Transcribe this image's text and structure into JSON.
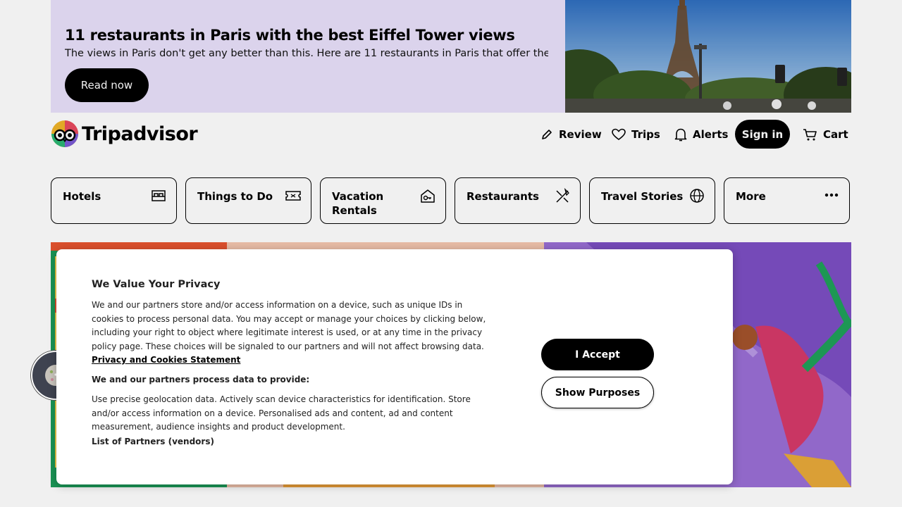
{
  "promo": {
    "title": "11 restaurants in Paris with the best Eiffel Tower views",
    "description": "The views in Paris don't get any better than this. Here are 11 restaurants in Paris that offer the ...",
    "button_label": "Read now"
  },
  "header": {
    "brand": "Tripadvisor",
    "nav": {
      "review": "Review",
      "trips": "Trips",
      "alerts": "Alerts",
      "signin": "Sign in",
      "cart": "Cart"
    }
  },
  "categories": [
    {
      "label": "Hotels",
      "icon": "bed-icon"
    },
    {
      "label": "Things to Do",
      "icon": "ticket-icon"
    },
    {
      "label": "Vacation Rentals",
      "icon": "house-key-icon"
    },
    {
      "label": "Restaurants",
      "icon": "fork-knife-icon"
    },
    {
      "label": "Travel Stories",
      "icon": "globe-icon"
    },
    {
      "label": "More",
      "icon": "more-dots-icon"
    }
  ],
  "consent": {
    "title": "We Value Your Privacy",
    "body": "We and our partners store and/or access information on a device, such as unique IDs in cookies to process personal data. You may accept or manage your choices by clicking below, including your right to object where legitimate interest is used, or at any time in the privacy policy page. These choices will be signaled to our partners and will not affect browsing data.",
    "policy_link": "Privacy and Cookies Statement",
    "purposes_heading": "We and our partners process data to provide:",
    "purposes_text": "Use precise geolocation data. Actively scan device characteristics for identification. Store and/or access information on a device. Personalised ads and content, ad and content measurement, audience insights and product development.",
    "partners_link": "List of Partners (vendors)",
    "accept_label": "I Accept",
    "purposes_label": "Show Purposes"
  },
  "colors": {
    "promo_bg": "#e9e1fb",
    "button_black": "#000000",
    "hero_purple": "#9b6fd6",
    "hero_green": "#1fa15a",
    "cookie_fab": "#3f4350"
  }
}
